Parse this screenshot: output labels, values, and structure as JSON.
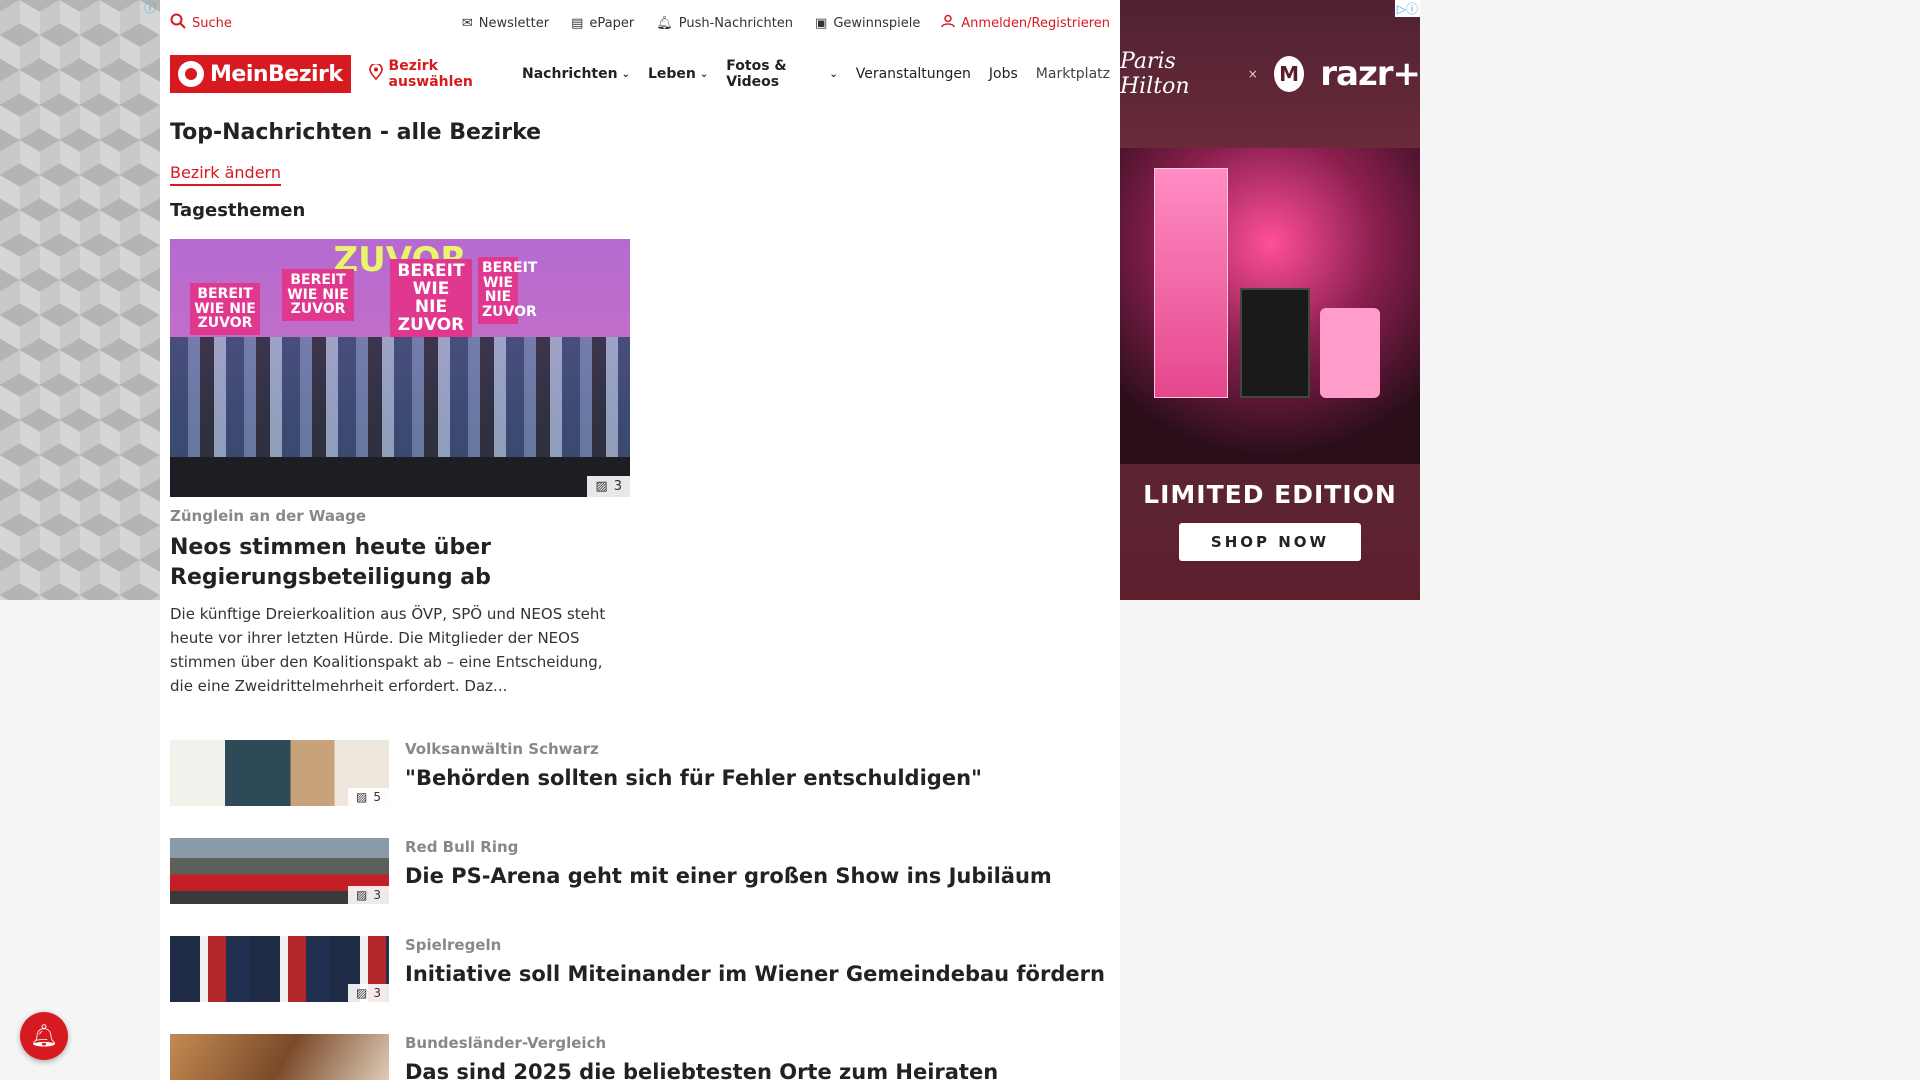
{
  "left_ad": {
    "info_icon": "info-icon"
  },
  "topbar": {
    "search_label": "Suche",
    "utils": [
      {
        "label": "Newsletter",
        "icon": "envelope-icon"
      },
      {
        "label": "ePaper",
        "icon": "newspaper-icon"
      },
      {
        "label": "Push-Nachrichten",
        "icon": "bell-icon"
      },
      {
        "label": "Gewinnspiele",
        "icon": "gift-icon"
      }
    ],
    "login_label": "Anmelden/Registrieren"
  },
  "navbar": {
    "logo_text": "MeinBezirk",
    "bezirk_select": "Bezirk auswählen",
    "items": [
      {
        "label": "Nachrichten",
        "dropdown": true
      },
      {
        "label": "Leben",
        "dropdown": true
      },
      {
        "label": "Fotos & Videos",
        "dropdown": true
      },
      {
        "label": "Veranstaltungen",
        "dropdown": false
      },
      {
        "label": "Jobs",
        "dropdown": false
      },
      {
        "label": "Marktplatz",
        "dropdown": false
      }
    ]
  },
  "content": {
    "page_title": "Top-Nachrichten - alle Bezirke",
    "change_link": "Bezirk ändern",
    "section_head": "Tagesthemen",
    "hero": {
      "sign_text": "BEREIT WIE NIE ZUVOR",
      "top_text": "ZUVOR",
      "image_count": "3",
      "kicker": "Zünglein an der Waage",
      "title": "Neos stimmen heute über Regierungsbeteiligung ab",
      "teaser": "Die künftige Dreierkoalition aus ÖVP, SPÖ und NEOS steht heute vor ihrer letzten Hürde. Die Mitglieder der NEOS stimmen über den Koalitionspakt ab – eine Entscheidung, die eine Zweidrittelmehrheit erfordert. Daz..."
    },
    "articles": [
      {
        "kicker": "Volksanwältin Schwarz",
        "title": "\"Behörden sollten sich für Fehler entschuldigen\"",
        "image_count": "5"
      },
      {
        "kicker": "Red Bull Ring",
        "title": "Die PS-Arena geht mit einer großen Show ins Jubiläum",
        "image_count": "3"
      },
      {
        "kicker": "Spielregeln",
        "title": "Initiative soll Miteinander im Wiener Gemeindebau fördern",
        "image_count": "3"
      },
      {
        "kicker": "Bundesländer-Vergleich",
        "title": "Das sind 2025 die beliebtesten Orte zum Heiraten",
        "image_count": ""
      }
    ]
  },
  "right_ad": {
    "brand1": "Paris Hilton",
    "x": "×",
    "moto_letter": "M",
    "brand2": "razr+",
    "headline": "LIMITED EDITION",
    "cta": "SHOP NOW",
    "info": "▷ⓘ"
  },
  "colors": {
    "brand_red": "#d71920",
    "ad_bg": "#5a1d2b"
  }
}
